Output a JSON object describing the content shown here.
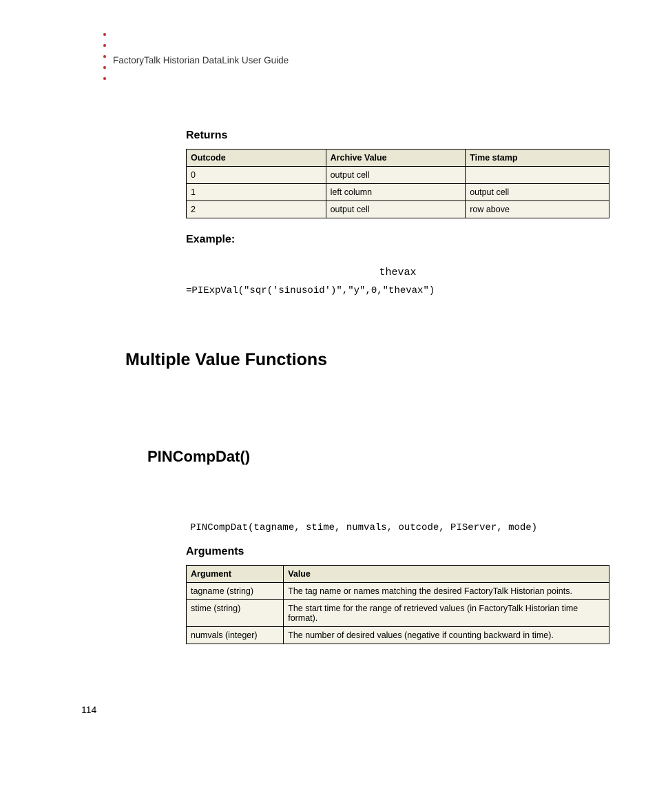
{
  "header": {
    "running_title": "FactoryTalk Historian DataLink User Guide"
  },
  "returns": {
    "heading": "Returns",
    "cols": [
      "Outcode",
      "Archive Value",
      "Time stamp"
    ],
    "rows": [
      [
        "0",
        "output cell",
        ""
      ],
      [
        "1",
        "left column",
        "output cell"
      ],
      [
        "2",
        "output cell",
        "row above"
      ]
    ]
  },
  "example": {
    "heading": "Example:",
    "center_code": "thevax",
    "code_line": "=PIExpVal(\"sqr('sinusoid')\",\"y\",0,\"thevax\")"
  },
  "section1": {
    "title": "Multiple Value Functions"
  },
  "section2": {
    "title": "PINCompDat()",
    "signature": "PINCompDat(tagname, stime, numvals, outcode, PIServer, mode)"
  },
  "arguments": {
    "heading": "Arguments",
    "cols": [
      "Argument",
      "Value"
    ],
    "rows": [
      [
        "tagname (string)",
        "The tag name or names matching the desired FactoryTalk Historian points."
      ],
      [
        "stime (string)",
        "The start time for the range of retrieved values (in FactoryTalk Historian time format)."
      ],
      [
        "numvals (integer)",
        "The number of desired values (negative if counting backward in time)."
      ]
    ]
  },
  "page_number": "114"
}
